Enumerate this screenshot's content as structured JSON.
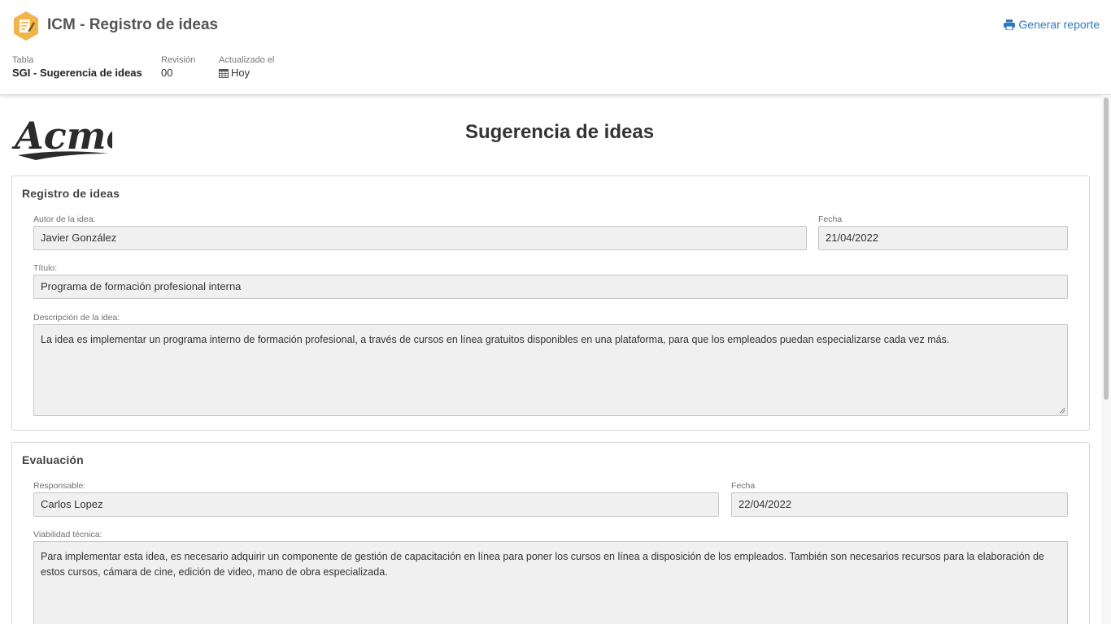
{
  "header": {
    "title": "ICM - Registro de ideas",
    "report_label": "Generar reporte",
    "table_label": "Tabla",
    "table_value": "SGI - Sugerencia de ideas",
    "revision_label": "Revisión",
    "revision_value": "00",
    "updated_label": "Actualizado el",
    "updated_value": "Hoy",
    "icons": {
      "app": "edit-document-icon",
      "report": "printer-icon",
      "updated": "calendar-icon"
    },
    "colors": {
      "app_icon": "#f0b54a",
      "link": "#2e79c0"
    }
  },
  "document": {
    "logo_text": "Acme",
    "title": "Sugerencia de ideas"
  },
  "registro": {
    "section_title": "Registro de ideas",
    "author_label": "Autor de la idea:",
    "author_value": "Javier González",
    "date_label": "Fecha",
    "date_value": "21/04/2022",
    "title_label": "Título:",
    "title_value": "Programa de formación profesional interna",
    "description_label": "Descripción de la idea:",
    "description_value": "La idea es implementar un programa interno de formación profesional, a través de cursos en línea gratuitos disponibles en una plataforma, para que los empleados puedan especializarse cada vez más."
  },
  "evaluacion": {
    "section_title": "Evaluación",
    "responsible_label": "Responsable:",
    "responsible_value": "Carlos Lopez",
    "date_label": "Fecha",
    "date_value": "22/04/2022",
    "viability_label": "Viabilidad técnica:",
    "viability_value": "Para implementar esta idea, es necesario adquirir un componente de gestión de capacitación en línea para poner los cursos en línea a disposición de los empleados. También son necesarios recursos para la elaboración de estos cursos, cámara de cine, edición de video, mano de obra especializada."
  }
}
